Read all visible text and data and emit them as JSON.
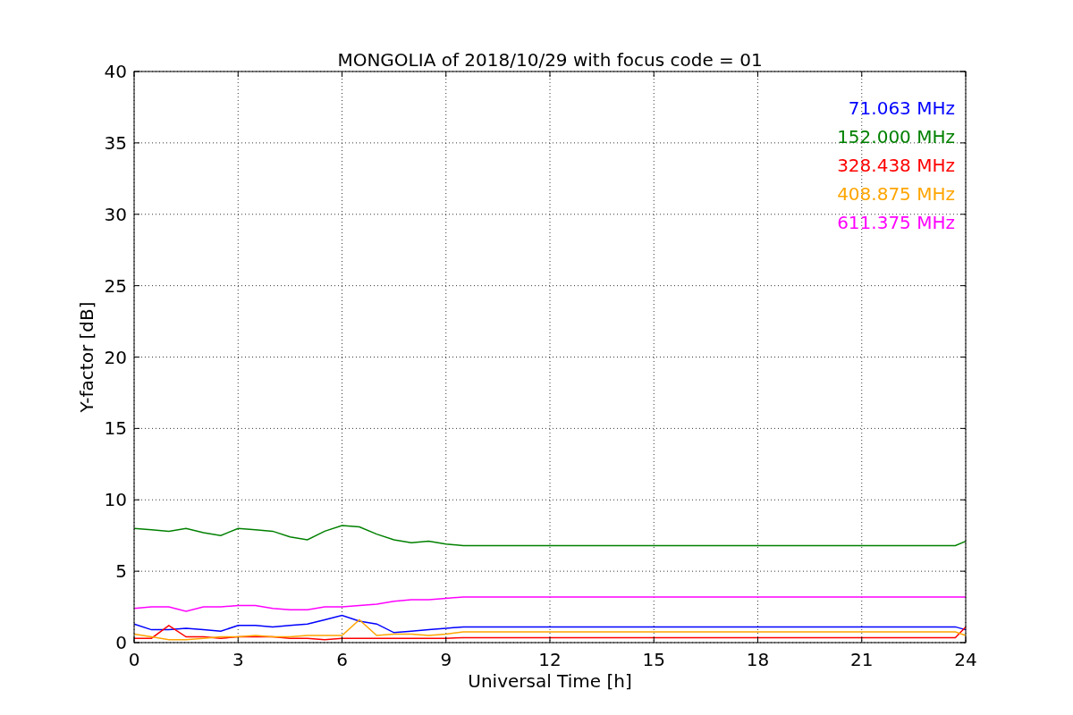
{
  "chart_data": {
    "type": "line",
    "title": "MONGOLIA of 2018/10/29 with focus code = 01",
    "xlabel": "Universal Time [h]",
    "ylabel": "Y-factor [dB]",
    "x": [
      0,
      0.5,
      1,
      1.5,
      2,
      2.5,
      3,
      3.5,
      4,
      4.5,
      5,
      5.5,
      6,
      6.5,
      7,
      7.5,
      8,
      8.5,
      9,
      9.5,
      23.7,
      24
    ],
    "series": [
      {
        "name": "71.063 MHz",
        "color": "#0000ff",
        "values": [
          1.3,
          0.9,
          0.9,
          1.0,
          0.9,
          0.8,
          1.2,
          1.2,
          1.1,
          1.2,
          1.3,
          1.6,
          1.9,
          1.5,
          1.3,
          0.7,
          0.8,
          0.9,
          1.0,
          1.1,
          1.1,
          0.9
        ]
      },
      {
        "name": "152.000 MHz",
        "color": "#008000",
        "values": [
          8.0,
          7.9,
          7.8,
          8.0,
          7.7,
          7.5,
          8.0,
          7.9,
          7.8,
          7.4,
          7.2,
          7.8,
          8.2,
          8.1,
          7.6,
          7.2,
          7.0,
          7.1,
          6.9,
          6.8,
          6.8,
          7.1
        ]
      },
      {
        "name": "328.438 MHz",
        "color": "#ff0000",
        "values": [
          0.3,
          0.3,
          1.2,
          0.4,
          0.4,
          0.3,
          0.4,
          0.4,
          0.4,
          0.3,
          0.3,
          0.2,
          0.3,
          0.3,
          0.3,
          0.3,
          0.3,
          0.3,
          0.3,
          0.35,
          0.35,
          1.1
        ]
      },
      {
        "name": "408.875 MHz",
        "color": "#ffa500",
        "values": [
          0.6,
          0.4,
          0.2,
          0.2,
          0.3,
          0.4,
          0.4,
          0.5,
          0.4,
          0.4,
          0.5,
          0.5,
          0.5,
          1.6,
          0.5,
          0.6,
          0.6,
          0.5,
          0.6,
          0.75,
          0.75,
          0.5
        ]
      },
      {
        "name": "611.375 MHz",
        "color": "#ff00ff",
        "values": [
          2.4,
          2.5,
          2.5,
          2.2,
          2.5,
          2.5,
          2.6,
          2.6,
          2.4,
          2.3,
          2.3,
          2.5,
          2.5,
          2.6,
          2.7,
          2.9,
          3.0,
          3.0,
          3.1,
          3.2,
          3.2,
          3.2
        ]
      }
    ],
    "grid": true,
    "xlim": [
      0,
      24
    ],
    "ylim": [
      0,
      40
    ],
    "xticks": [
      0,
      3,
      6,
      9,
      12,
      15,
      18,
      21,
      24
    ],
    "yticks": [
      0,
      5,
      10,
      15,
      20,
      25,
      30,
      35,
      40
    ]
  }
}
